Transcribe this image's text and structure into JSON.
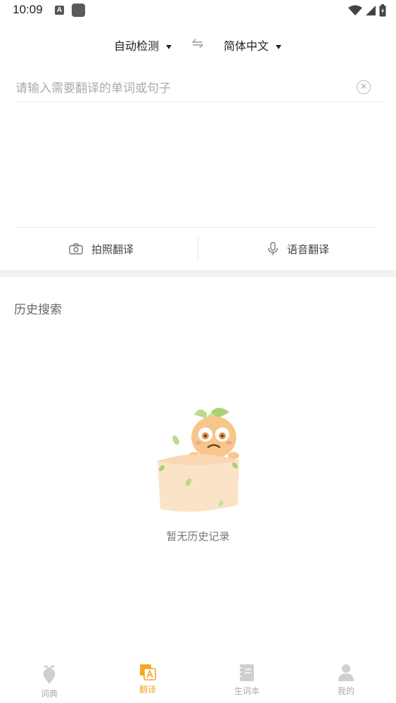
{
  "status_bar": {
    "time": "10:09",
    "badge_letter": "A"
  },
  "language": {
    "source": "自动检测",
    "target": "简体中文"
  },
  "input": {
    "placeholder": "请输入需要翻译的单词或句子",
    "value": ""
  },
  "actions": {
    "photo_label": "拍照翻译",
    "voice_label": "语音翻译"
  },
  "history": {
    "title": "历史搜索",
    "empty_text": "暂无历史记录"
  },
  "bottom_nav": {
    "items": [
      {
        "label": "词典",
        "icon": "radish-icon",
        "active": false
      },
      {
        "label": "翻译",
        "icon": "translate-icon",
        "active": true
      },
      {
        "label": "生词本",
        "icon": "notebook-icon",
        "active": false
      },
      {
        "label": "我的",
        "icon": "person-icon",
        "active": false
      }
    ]
  },
  "colors": {
    "accent": "#f5a623",
    "inactive": "#aaaaaa",
    "divider": "#f2f2f2"
  }
}
